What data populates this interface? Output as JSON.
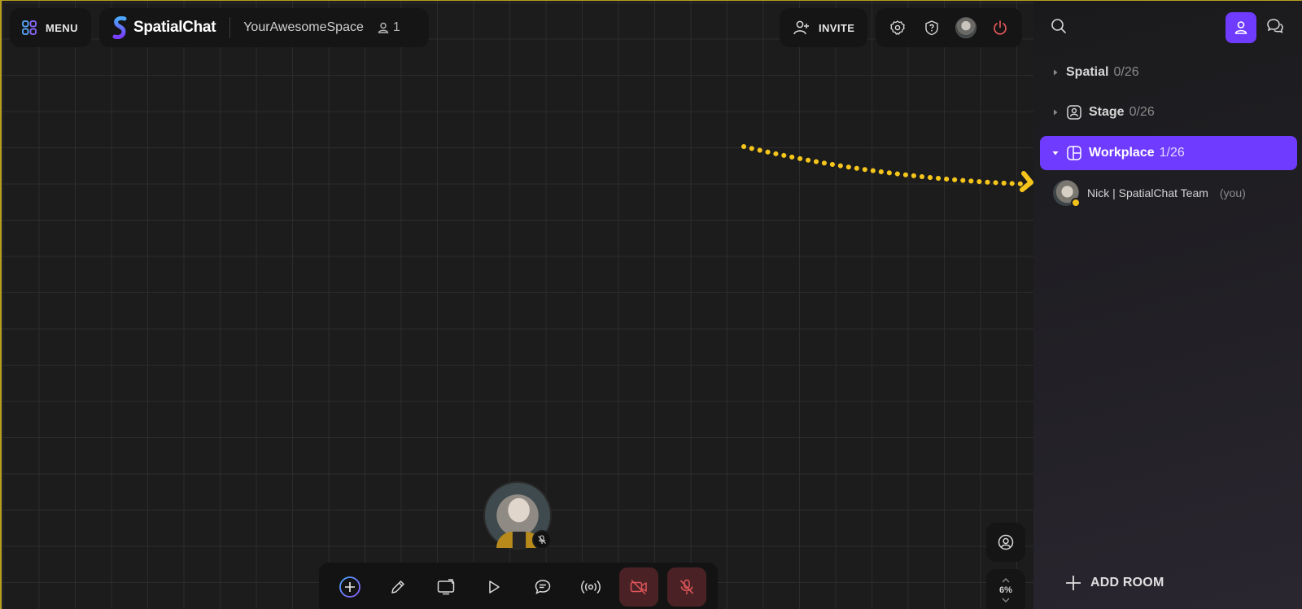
{
  "header": {
    "menu_label": "MENU",
    "brand_name": "SpatialChat",
    "space_name": "YourAwesomeSpace",
    "user_count": "1",
    "invite_label": "INVITE"
  },
  "sidebar": {
    "rooms": [
      {
        "name": "Spatial",
        "count": "0/26",
        "active": false
      },
      {
        "name": "Stage",
        "count": "0/26",
        "active": false
      },
      {
        "name": "Workplace",
        "count": "1/26",
        "active": true
      }
    ],
    "member": {
      "name": "Nick | SpatialChat Team",
      "tag": "(you)"
    },
    "add_room_label": "ADD ROOM"
  },
  "canvas": {
    "zoom_level": "6%"
  },
  "colors": {
    "accent": "#6f3bff",
    "annotation_arrow": "#f5c51b",
    "danger_bg": "#4a2225",
    "power_icon": "#e0565b"
  },
  "icons": {
    "menu": "grid-icon",
    "invite": "add-user-icon",
    "settings": "gear-icon",
    "help": "question-icon",
    "power": "power-icon",
    "search": "search-icon",
    "people": "people-icon",
    "chat": "chat-icon"
  }
}
